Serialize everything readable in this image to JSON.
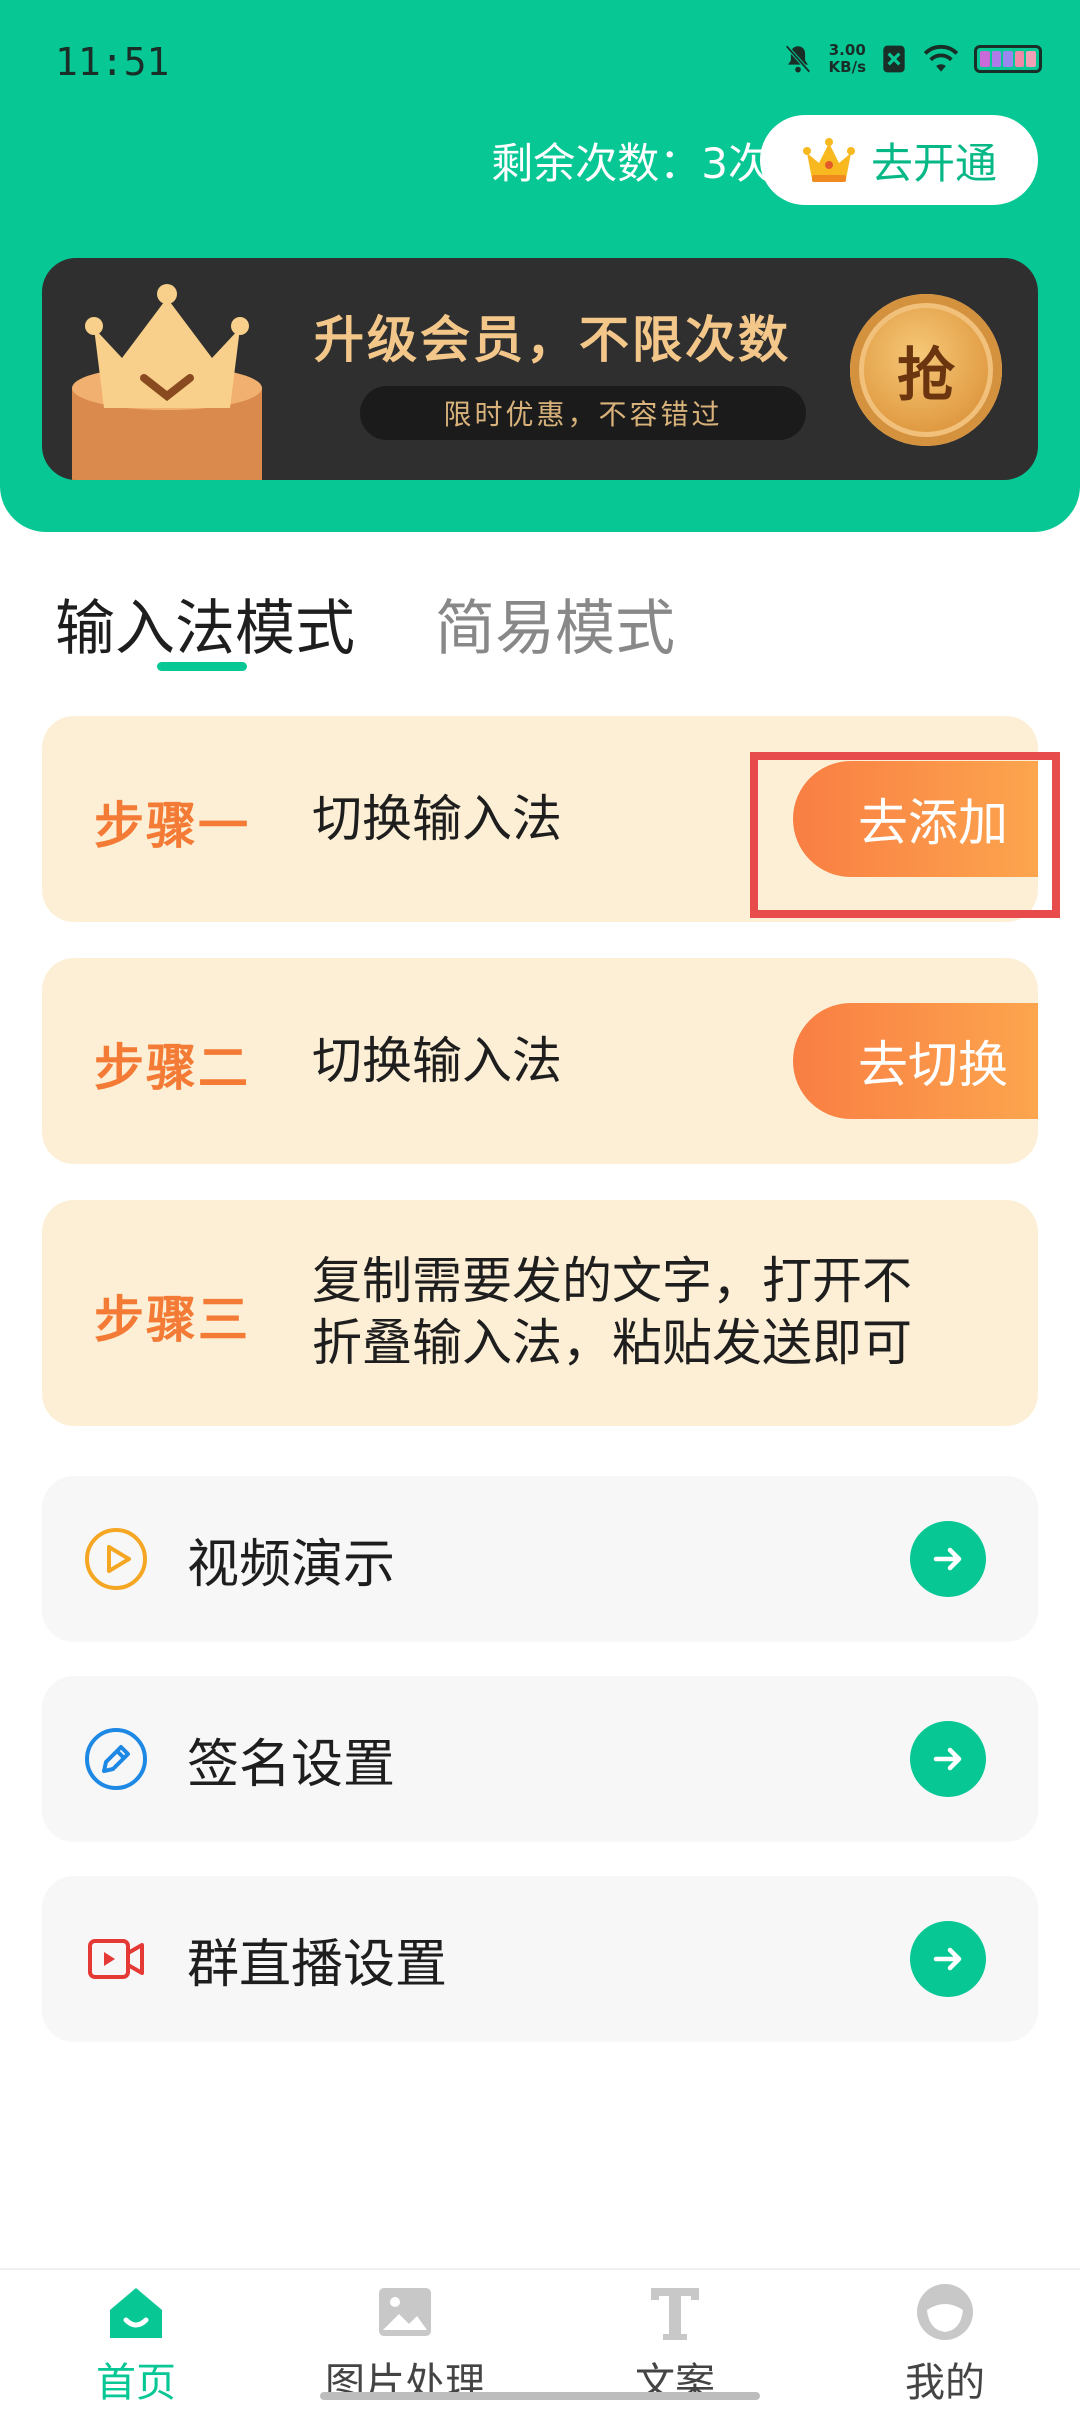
{
  "status_bar": {
    "time": "11:51",
    "net_speed_value": "3.00",
    "net_speed_unit": "KB/s"
  },
  "header": {
    "remaining_text": "剩余次数：3次",
    "vip_button_label": "去开通",
    "accent_color": "#07c794"
  },
  "banner": {
    "title": "升级会员，不限次数",
    "subtitle": "限时优惠，不容错过",
    "grab_label": "抢"
  },
  "tabs": [
    {
      "label": "输入法模式",
      "active": true
    },
    {
      "label": "简易模式",
      "active": false
    }
  ],
  "steps": [
    {
      "label": "步骤一",
      "desc": "切换输入法",
      "button": "去添加"
    },
    {
      "label": "步骤二",
      "desc": "切换输入法",
      "button": "去切换"
    },
    {
      "label": "步骤三",
      "desc_line1": "复制需要发的文字，打开不",
      "desc_line2": "折叠输入法，粘贴发送即可"
    }
  ],
  "menu": [
    {
      "label": "视频演示",
      "icon": "play-circle-icon"
    },
    {
      "label": "签名设置",
      "icon": "pen-circle-icon"
    },
    {
      "label": "群直播设置",
      "icon": "video-camera-icon"
    }
  ],
  "bottom_nav": [
    {
      "label": "首页",
      "icon": "home-icon",
      "active": true
    },
    {
      "label": "图片处理",
      "icon": "image-icon",
      "active": false
    },
    {
      "label": "文案",
      "icon": "text-icon",
      "active": false
    },
    {
      "label": "我的",
      "icon": "profile-icon",
      "active": false
    }
  ]
}
